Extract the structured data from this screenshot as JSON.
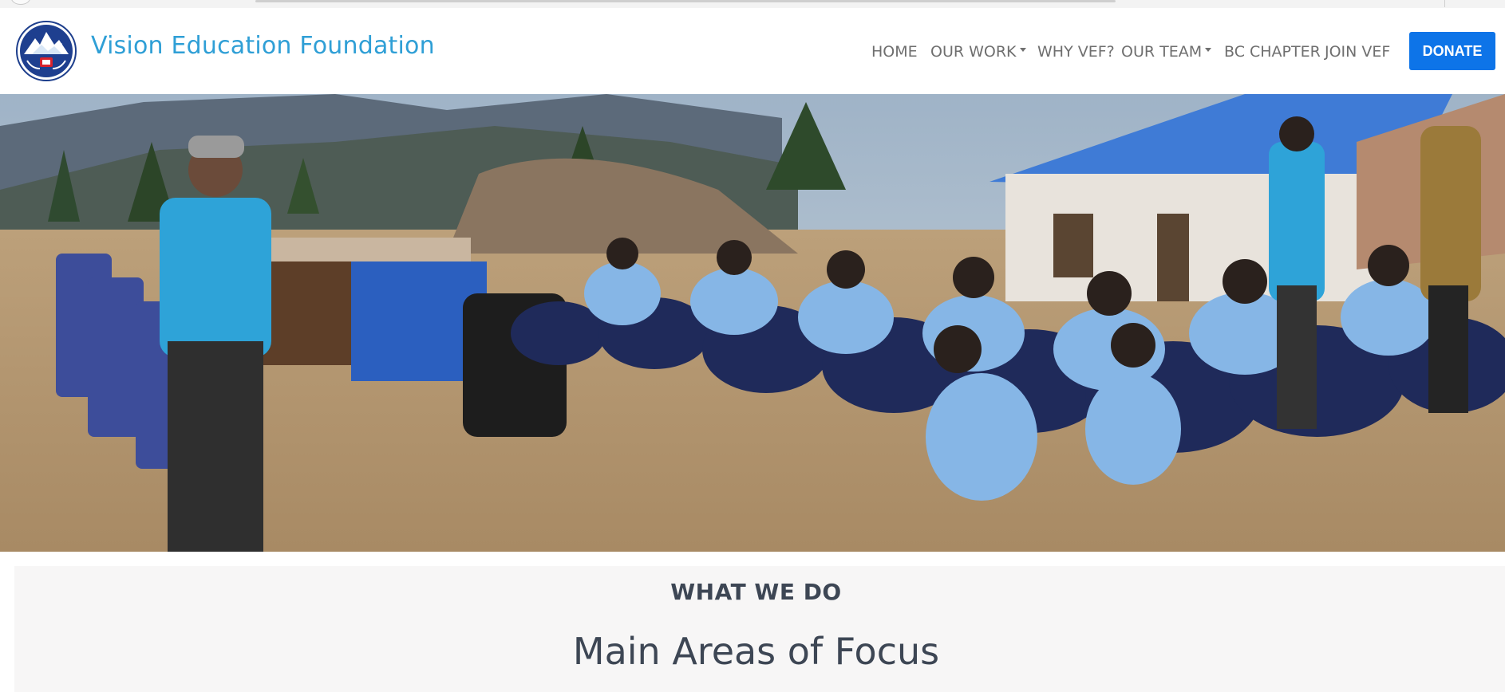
{
  "brand": {
    "name": "Vision Education Foundation",
    "logo_icon": "vef-logo-icon"
  },
  "nav": {
    "items": [
      {
        "label": "HOME",
        "dropdown": false
      },
      {
        "label": "OUR WORK",
        "dropdown": true
      },
      {
        "label": "WHY VEF?",
        "dropdown": false
      },
      {
        "label": "OUR TEAM",
        "dropdown": true
      },
      {
        "label": "BC CHAPTER",
        "dropdown": false
      },
      {
        "label": "JOIN VEF",
        "dropdown": false
      }
    ],
    "donate_label": "DONATE"
  },
  "colors": {
    "brand_blue": "#2f9fd6",
    "donate_blue": "#0d74e8",
    "heading": "#3d4654"
  },
  "hero": {
    "image_alt": "hero-photo"
  },
  "section": {
    "eyebrow": "WHAT WE DO",
    "title": "Main Areas of Focus"
  }
}
